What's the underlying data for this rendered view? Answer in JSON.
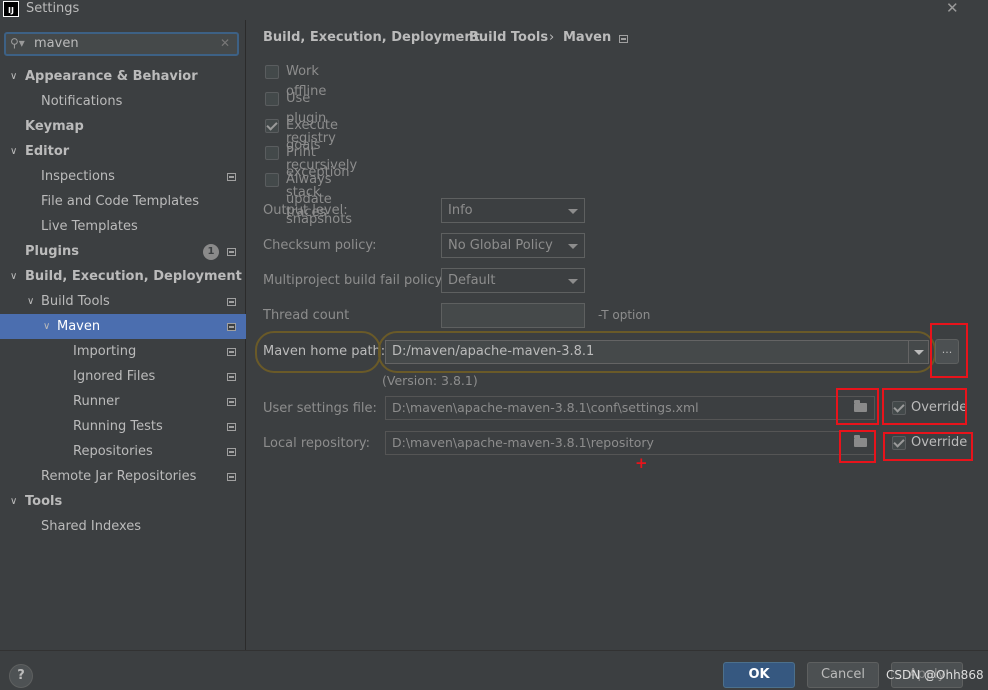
{
  "window": {
    "title": "Settings",
    "app_icon": "IJ"
  },
  "search": {
    "value": "maven",
    "icon": "search-icon",
    "clear_icon": "clear-icon"
  },
  "sidebar": {
    "items": [
      {
        "label": "Appearance & Behavior",
        "level": 0,
        "bold": true,
        "expanded": true
      },
      {
        "label": "Notifications",
        "level": 1
      },
      {
        "label": "Keymap",
        "level": 0,
        "bold": true
      },
      {
        "label": "Editor",
        "level": 0,
        "bold": true,
        "expanded": true
      },
      {
        "label": "Inspections",
        "level": 1,
        "project_icon": true
      },
      {
        "label": "File and Code Templates",
        "level": 1
      },
      {
        "label": "Live Templates",
        "level": 1
      },
      {
        "label": "Plugins",
        "level": 0,
        "bold": true,
        "badge": "1",
        "project_icon": true
      },
      {
        "label": "Build, Execution, Deployment",
        "level": 0,
        "bold": true,
        "expanded": true
      },
      {
        "label": "Build Tools",
        "level": 1,
        "expanded": true,
        "project_icon": true
      },
      {
        "label": "Maven",
        "level": 2,
        "expanded": true,
        "selected": true,
        "project_icon": true
      },
      {
        "label": "Importing",
        "level": 3,
        "project_icon": true
      },
      {
        "label": "Ignored Files",
        "level": 3,
        "project_icon": true
      },
      {
        "label": "Runner",
        "level": 3,
        "project_icon": true
      },
      {
        "label": "Running Tests",
        "level": 3,
        "project_icon": true
      },
      {
        "label": "Repositories",
        "level": 3,
        "project_icon": true
      },
      {
        "label": "Remote Jar Repositories",
        "level": 1,
        "project_icon": true
      },
      {
        "label": "Tools",
        "level": 0,
        "bold": true,
        "expanded": true
      },
      {
        "label": "Shared Indexes",
        "level": 1
      }
    ]
  },
  "breadcrumb": {
    "items": [
      "Build, Execution, Deployment",
      "Build Tools",
      "Maven"
    ],
    "separator": "›"
  },
  "options": [
    {
      "label": "Work offline",
      "checked": false
    },
    {
      "label": "Use plugin registry",
      "checked": false
    },
    {
      "label": "Execute goals recursively",
      "checked": true
    },
    {
      "label": "Print exception stack traces",
      "checked": false
    },
    {
      "label": "Always update snapshots",
      "checked": false
    }
  ],
  "fields": {
    "output_level": {
      "label": "Output level:",
      "value": "Info"
    },
    "checksum_policy": {
      "label": "Checksum policy:",
      "value": "No Global Policy"
    },
    "fail_policy": {
      "label": "Multiproject build fail policy:",
      "value": "Default"
    },
    "thread_count": {
      "label": "Thread count",
      "value": "",
      "hint": "-T option"
    },
    "maven_home": {
      "label": "Maven home path:",
      "value": "D:/maven/apache-maven-3.8.1",
      "browse": "...",
      "version": "(Version: 3.8.1)"
    },
    "user_settings": {
      "label": "User settings file:",
      "value": "D:\\maven\\apache-maven-3.8.1\\conf\\settings.xml",
      "override_label": "Override",
      "override": true
    },
    "local_repo": {
      "label": "Local repository:",
      "value": "D:\\maven\\apache-maven-3.8.1\\repository",
      "override_label": "Override",
      "override": true
    }
  },
  "annotation": {
    "color": "#e8131b",
    "plus": "+"
  },
  "footer": {
    "help": "?",
    "ok": "OK",
    "cancel": "Cancel",
    "apply": "Apply",
    "watermark": "CSDN @Ohh868"
  }
}
